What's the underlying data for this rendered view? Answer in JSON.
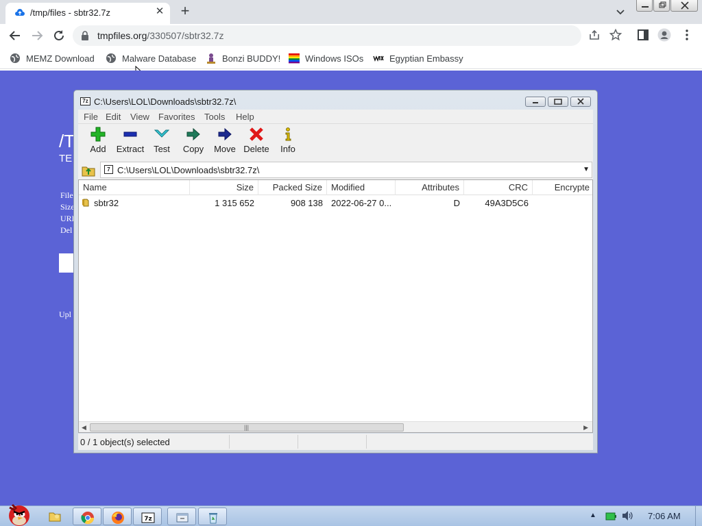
{
  "browser": {
    "tab_title": "/tmp/files - sbtr32.7z",
    "url_host": "tmpfiles.org",
    "url_path": "/330507/sbtr32.7z",
    "bookmarks": [
      {
        "label": "MEMZ Download",
        "icon": "globe-icon"
      },
      {
        "label": "Malware Database",
        "icon": "globe-icon"
      },
      {
        "label": "Bonzi BUDDY!",
        "icon": "bonzi-icon"
      },
      {
        "label": "Windows ISOs",
        "icon": "rainbow-flag-icon"
      },
      {
        "label": "Egyptian Embassy",
        "icon": "wix-icon"
      }
    ]
  },
  "page": {
    "heading": "/T",
    "subheading": "TE",
    "lines": [
      "File",
      "Size",
      "URL",
      "Del"
    ],
    "upload": "Upl"
  },
  "zip": {
    "title": "C:\\Users\\LOL\\Downloads\\sbtr32.7z\\",
    "menu": [
      "File",
      "Edit",
      "View",
      "Favorites",
      "Tools",
      "Help"
    ],
    "tools": [
      "Add",
      "Extract",
      "Test",
      "Copy",
      "Move",
      "Delete",
      "Info"
    ],
    "path": "C:\\Users\\LOL\\Downloads\\sbtr32.7z\\",
    "columns": [
      "Name",
      "Size",
      "Packed Size",
      "Modified",
      "Attributes",
      "CRC",
      "Encrypte"
    ],
    "rows": [
      {
        "name": "sbtr32",
        "size": "1 315 652",
        "packed": "908 138",
        "modified": "2022-06-27 0...",
        "attributes": "D",
        "crc": "49A3D5C6",
        "encrypted": ""
      }
    ],
    "status": "0 / 1 object(s) selected"
  },
  "taskbar": {
    "clock": "7:06 AM",
    "apps": [
      "chrome-icon",
      "firefox-icon",
      "7zip-icon",
      "window-icon",
      "recycle-icon"
    ]
  },
  "colors": {
    "page_bg": "#5b63d6",
    "tab_strip": "#dee1e6",
    "taskbar": "#b4cbe8"
  }
}
